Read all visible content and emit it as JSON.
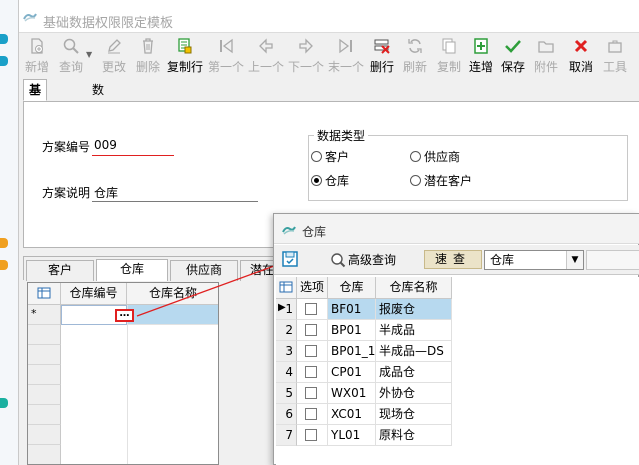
{
  "window": {
    "title": "基础数据权限限定模板"
  },
  "toolbar": {
    "items": [
      {
        "label": "新增",
        "icon": "new-doc-icon",
        "enabled": false
      },
      {
        "label": "查询",
        "icon": "search-icon",
        "enabled": false
      },
      {
        "label": "更改",
        "icon": "pencil-icon",
        "enabled": false
      },
      {
        "label": "删除",
        "icon": "trash-icon",
        "enabled": false
      },
      {
        "label": "复制行",
        "icon": "copy-rows-icon",
        "enabled": true
      },
      {
        "label": "第一个",
        "icon": "first-icon",
        "enabled": false
      },
      {
        "label": "上一个",
        "icon": "prev-icon",
        "enabled": false
      },
      {
        "label": "下一个",
        "icon": "next-icon",
        "enabled": false
      },
      {
        "label": "末一个",
        "icon": "last-icon",
        "enabled": false
      },
      {
        "label": "删行",
        "icon": "delete-row-icon",
        "enabled": true
      },
      {
        "label": "刷新",
        "icon": "refresh-icon",
        "enabled": false
      },
      {
        "label": "复制",
        "icon": "copy-icon",
        "enabled": false
      },
      {
        "label": "连增",
        "icon": "continuous-add-icon",
        "enabled": true
      },
      {
        "label": "保存",
        "icon": "check-icon",
        "enabled": true
      },
      {
        "label": "附件",
        "icon": "folder-icon",
        "enabled": false
      },
      {
        "label": "取消",
        "icon": "cancel-icon",
        "enabled": true
      },
      {
        "label": "工具",
        "icon": "tools-icon",
        "enabled": false
      }
    ]
  },
  "tabs": {
    "basic": "基本数据",
    "browse": "数据浏览"
  },
  "form": {
    "scheme_no_label": "方案编号",
    "scheme_no": "009",
    "scheme_desc_label": "方案说明",
    "scheme_desc": "仓库",
    "data_type_title": "数据类型",
    "radios": [
      {
        "label": "客户",
        "checked": false
      },
      {
        "label": "供应商",
        "checked": false
      },
      {
        "label": "仓库",
        "checked": true
      },
      {
        "label": "潜在客户",
        "checked": false
      }
    ]
  },
  "subtabs": [
    "客户",
    "仓库",
    "供应商",
    "潜在"
  ],
  "grid": {
    "col_code": "仓库编号",
    "col_name": "仓库名称",
    "new_row_marker": "*",
    "ellipsis": "…"
  },
  "popup": {
    "title": "仓库",
    "advanced_query": "高级查询",
    "quick_search": "速查",
    "combo_value": "仓库",
    "headers": {
      "option": "选项",
      "code": "仓库",
      "name": "仓库名称"
    },
    "rows": [
      {
        "no": "1",
        "code": "BF01",
        "name": "报废仓"
      },
      {
        "no": "2",
        "code": "BP01",
        "name": "半成品"
      },
      {
        "no": "3",
        "code": "BP01_1",
        "name": "半成品—DS"
      },
      {
        "no": "4",
        "code": "CP01",
        "name": "成品仓"
      },
      {
        "no": "5",
        "code": "WX01",
        "name": "外协仓"
      },
      {
        "no": "6",
        "code": "XC01",
        "name": "现场仓"
      },
      {
        "no": "7",
        "code": "YL01",
        "name": "原料仓"
      }
    ]
  },
  "colors": {
    "accent_red": "#e02020",
    "selection": "#b7d9ef",
    "green": "#2e9e3a"
  }
}
